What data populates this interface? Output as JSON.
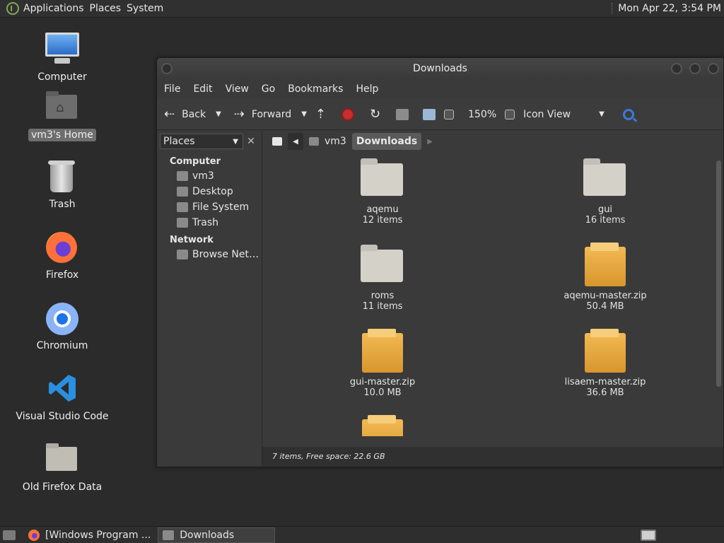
{
  "top_panel": {
    "menus": [
      "Applications",
      "Places",
      "System"
    ],
    "clock": "Mon Apr 22,  3:54 PM"
  },
  "desktop": {
    "icons": [
      {
        "label": "Computer",
        "icon": "computer-icon"
      },
      {
        "label": "vm3's Home",
        "icon": "home-folder-icon"
      },
      {
        "label": "Trash",
        "icon": "trash-icon"
      },
      {
        "label": "Firefox",
        "icon": "firefox-icon"
      },
      {
        "label": "Chromium",
        "icon": "chromium-icon"
      },
      {
        "label": "Visual Studio Code",
        "icon": "vscode-icon"
      },
      {
        "label": "Old Firefox Data",
        "icon": "folder-icon"
      }
    ]
  },
  "window": {
    "title": "Downloads",
    "menu": [
      "File",
      "Edit",
      "View",
      "Go",
      "Bookmarks",
      "Help"
    ],
    "toolbar": {
      "back": "Back",
      "forward": "Forward",
      "zoom": "150%",
      "view_mode": "Icon View"
    },
    "sidebar": {
      "selector": "Places",
      "sections": [
        {
          "heading": "Computer",
          "items": [
            "vm3",
            "Desktop",
            "File System",
            "Trash"
          ]
        },
        {
          "heading": "Network",
          "items": [
            "Browse Net…"
          ]
        }
      ]
    },
    "pathbar": {
      "crumbs": [
        "vm3",
        "Downloads"
      ]
    },
    "files": [
      {
        "name": "aqemu",
        "info": "12 items",
        "type": "folder"
      },
      {
        "name": "gui",
        "info": "16 items",
        "type": "folder"
      },
      {
        "name": "roms",
        "info": "11 items",
        "type": "folder"
      },
      {
        "name": "aqemu-master.zip",
        "info": "50.4 MB",
        "type": "archive"
      },
      {
        "name": "gui-master.zip",
        "info": "10.0 MB",
        "type": "archive"
      },
      {
        "name": "lisaem-master.zip",
        "info": "36.6 MB",
        "type": "archive"
      }
    ],
    "status": "7 items, Free space: 22.6 GB"
  },
  "taskbar": {
    "tasks": [
      "[Windows Program ...",
      "Downloads"
    ]
  }
}
